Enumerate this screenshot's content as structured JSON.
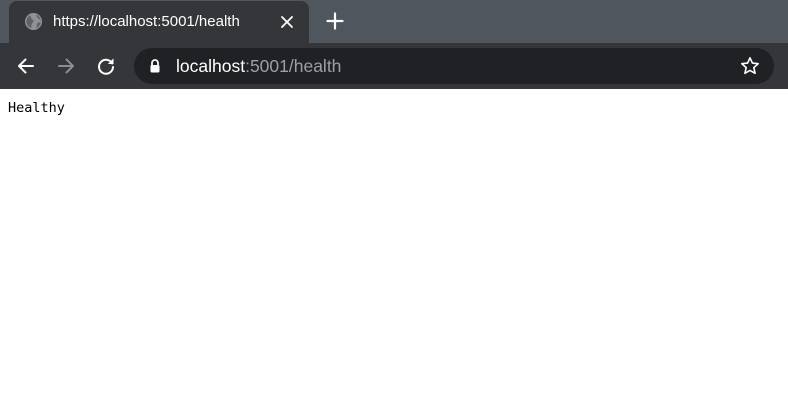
{
  "tab": {
    "title": "https://localhost:5001/health",
    "favicon_icon": "globe-icon",
    "close_icon": "close-icon"
  },
  "new_tab_icon": "plus-icon",
  "toolbar": {
    "back_icon": "arrow-left-icon",
    "forward_icon": "arrow-right-icon",
    "reload_icon": "reload-icon",
    "omnibox": {
      "lock_icon": "lock-icon",
      "url_host": "localhost",
      "url_rest": ":5001/health",
      "bookmark_icon": "star-icon"
    }
  },
  "page": {
    "body_text": "Healthy"
  },
  "colors": {
    "tabstrip_bg": "#4f565d",
    "tab_bg": "#35363a",
    "omnibox_bg": "#202124",
    "url_host": "#ffffff",
    "url_rest": "#9aa0a6",
    "page_bg": "#ffffff"
  }
}
